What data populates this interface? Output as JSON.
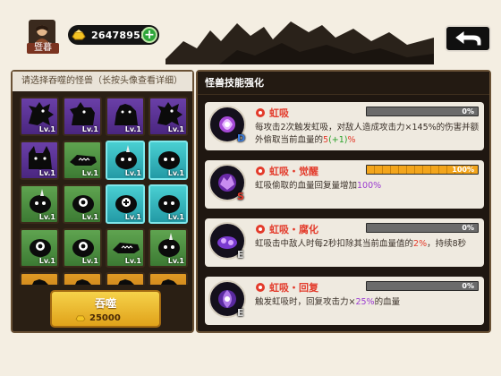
{
  "player": {
    "name": "暨暮",
    "avatar_icon": "player-avatar-icon"
  },
  "currency": {
    "gold": "26478955",
    "gold_icon": "gold-ingot-icon",
    "add_label": "+"
  },
  "navigation": {
    "back_icon": "return-arrow-icon"
  },
  "left_panel": {
    "header": "请选择吞噬的怪兽（长按头像查看详细）",
    "monsters": [
      {
        "level": "Lv.1",
        "rarity": "purple",
        "icon": "dragon-icon"
      },
      {
        "level": "Lv.1",
        "rarity": "purple",
        "icon": "hound-icon"
      },
      {
        "level": "Lv.1",
        "rarity": "purple",
        "icon": "beast-icon"
      },
      {
        "level": "Lv.1",
        "rarity": "purple",
        "icon": "dragon-icon"
      },
      {
        "level": "Lv.1",
        "rarity": "purple",
        "icon": "wolf-icon"
      },
      {
        "level": "Lv.1",
        "rarity": "green",
        "icon": "croc-icon"
      },
      {
        "level": "Lv.1",
        "rarity": "teal",
        "icon": "horn-blob-icon"
      },
      {
        "level": "Lv.1",
        "rarity": "teal",
        "icon": "blob-icon"
      },
      {
        "level": "Lv.1",
        "rarity": "green",
        "icon": "horn-blob-icon"
      },
      {
        "level": "Lv.1",
        "rarity": "green",
        "icon": "eye-blob-icon"
      },
      {
        "level": "Lv.1",
        "rarity": "teal",
        "icon": "cross-blob-icon"
      },
      {
        "level": "Lv.1",
        "rarity": "teal",
        "icon": "blob-icon"
      },
      {
        "level": "Lv.1",
        "rarity": "green",
        "icon": "eye-blob-icon"
      },
      {
        "level": "Lv.1",
        "rarity": "green",
        "icon": "eye-blob-icon"
      },
      {
        "level": "Lv.1",
        "rarity": "green",
        "icon": "croc-icon"
      },
      {
        "level": "Lv.1",
        "rarity": "green",
        "icon": "horn-blob-icon"
      },
      {
        "level": "",
        "rarity": "orange",
        "icon": "beast-icon"
      },
      {
        "level": "",
        "rarity": "orange",
        "icon": "beast-icon"
      },
      {
        "level": "",
        "rarity": "orange",
        "icon": "beast-icon"
      },
      {
        "level": "",
        "rarity": "orange",
        "icon": "beast-icon"
      }
    ],
    "devour_button": {
      "label": "吞噬",
      "cost": "25000"
    }
  },
  "right_panel": {
    "header": "怪兽技能强化",
    "skills": [
      {
        "name": "虹吸",
        "grade": "D",
        "progress": 0,
        "progress_text": "0%",
        "desc_parts": [
          "每攻击2次触发虹吸，对敌人造成攻击力×145%的伤害并额外偷取当前血量的",
          "5",
          "(+1)",
          "%"
        ]
      },
      {
        "name": "虹吸・觉醒",
        "grade": "S",
        "progress": 100,
        "progress_text": "100%",
        "desc_parts": [
          "虹吸偷取的血量回复量增加",
          "100%"
        ]
      },
      {
        "name": "虹吸・腐化",
        "grade": "E",
        "progress": 0,
        "progress_text": "0%",
        "desc_parts": [
          "虹吸击中敌人时每2秒扣除其当前血量值的",
          "2%",
          "，持续8秒"
        ]
      },
      {
        "name": "虹吸・回复",
        "grade": "E",
        "progress": 0,
        "progress_text": "0%",
        "desc_parts": [
          "触发虹吸时，回复攻击力×",
          "25%",
          "的血量"
        ]
      }
    ]
  },
  "colors": {
    "skill_name": "#e33a2a",
    "bar_fill": "#f3a51b",
    "devour_button": "#f6d24a",
    "plus_button": "#2ea53a"
  }
}
